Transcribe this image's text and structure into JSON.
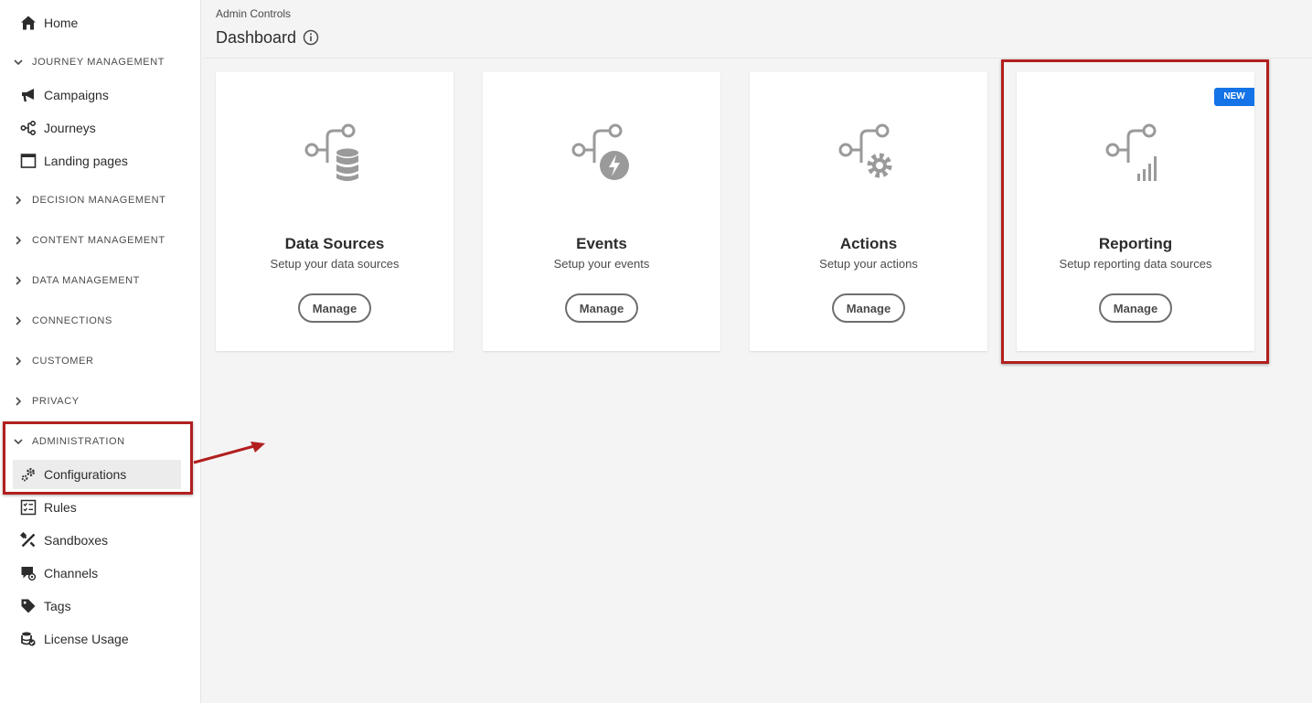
{
  "sidebar": {
    "home": "Home",
    "journey_management": {
      "label": "JOURNEY MANAGEMENT",
      "items": [
        "Campaigns",
        "Journeys",
        "Landing pages"
      ]
    },
    "collapsed_sections": [
      "DECISION MANAGEMENT",
      "CONTENT MANAGEMENT",
      "DATA MANAGEMENT",
      "CONNECTIONS",
      "CUSTOMER",
      "PRIVACY"
    ],
    "administration": {
      "label": "ADMINISTRATION",
      "items": [
        "Configurations",
        "Rules",
        "Sandboxes",
        "Channels",
        "Tags",
        "License Usage"
      ]
    }
  },
  "header": {
    "breadcrumb": "Admin Controls",
    "title": "Dashboard"
  },
  "cards": [
    {
      "title": "Data Sources",
      "description": "Setup your data sources",
      "button": "Manage",
      "icon": "data-sources-icon"
    },
    {
      "title": "Events",
      "description": "Setup your events",
      "button": "Manage",
      "icon": "events-icon"
    },
    {
      "title": "Actions",
      "description": "Setup your actions",
      "button": "Manage",
      "icon": "actions-icon"
    },
    {
      "title": "Reporting",
      "description": "Setup reporting data sources",
      "button": "Manage",
      "icon": "reporting-icon",
      "badge": "NEW"
    }
  ],
  "colors": {
    "accent": "#1473e6",
    "highlight": "#b21f1f",
    "icon_gray": "#9a9a9a"
  }
}
